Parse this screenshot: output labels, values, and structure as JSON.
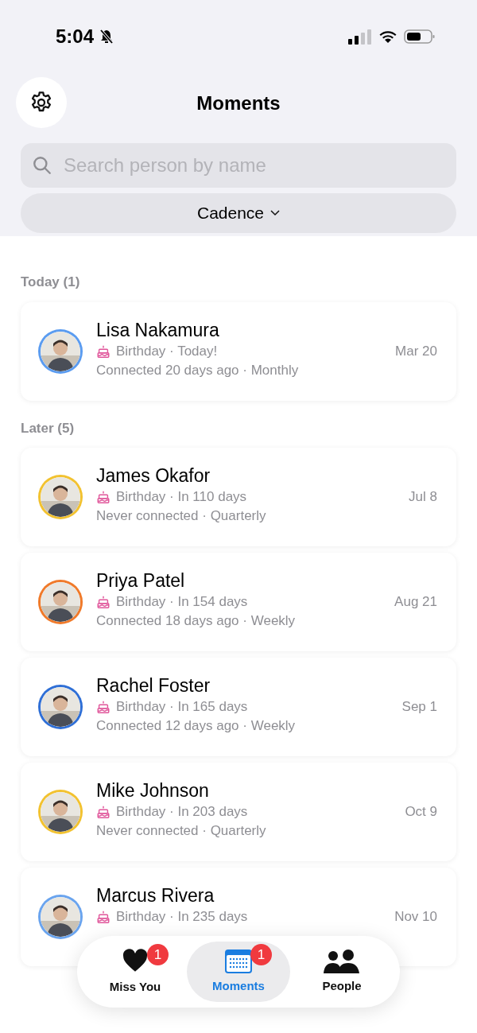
{
  "status_bar": {
    "time": "5:04"
  },
  "header": {
    "title": "Moments"
  },
  "search": {
    "placeholder": "Search person by name"
  },
  "filter": {
    "label": "Cadence"
  },
  "sections": [
    {
      "title": "Today (1)",
      "people": [
        {
          "name": "Lisa Nakamura",
          "color": "#5b9cf0",
          "birthday": "Birthday · Today!",
          "connection": "Connected 20 days ago · Monthly",
          "date": "Mar 20"
        }
      ]
    },
    {
      "title": "Later (5)",
      "people": [
        {
          "name": "James Okafor",
          "color": "#f2c230",
          "birthday": "Birthday · In 110 days",
          "connection": "Never connected · Quarterly",
          "date": "Jul 8"
        },
        {
          "name": "Priya Patel",
          "color": "#f07a2a",
          "birthday": "Birthday · In 154 days",
          "connection": "Connected 18 days ago · Weekly",
          "date": "Aug 21"
        },
        {
          "name": "Rachel Foster",
          "color": "#2f6fd6",
          "birthday": "Birthday · In 165 days",
          "connection": "Connected 12 days ago · Weekly",
          "date": "Sep 1"
        },
        {
          "name": "Mike Johnson",
          "color": "#f2c230",
          "birthday": "Birthday · In 203 days",
          "connection": "Never connected · Quarterly",
          "date": "Oct 9"
        },
        {
          "name": "Marcus Rivera",
          "color": "#6aa4ee",
          "birthday": "Birthday · In 235 days",
          "date": "Nov 10"
        }
      ]
    }
  ],
  "tabs": [
    {
      "kind": "heart",
      "label": "Miss You",
      "badge": "1",
      "selected": false
    },
    {
      "kind": "calendar",
      "label": "Moments",
      "badge": "1",
      "selected": true
    },
    {
      "kind": "people",
      "label": "People",
      "selected": false
    }
  ]
}
